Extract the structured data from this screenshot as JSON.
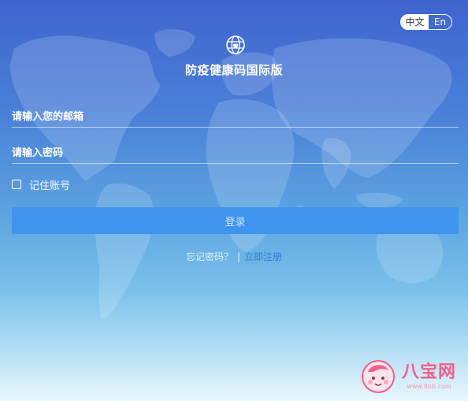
{
  "language": {
    "zh_label": "中文",
    "en_label": "En"
  },
  "header": {
    "title": "防疫健康码国际版",
    "logo_icon": "globe-heart-icon"
  },
  "form": {
    "email_placeholder": "请输入您的邮箱",
    "password_placeholder": "请输入密码",
    "remember_label": "记住账号",
    "remember_checked": false,
    "login_label": "登录"
  },
  "links": {
    "forgot": "忘记密码？",
    "divider": "|",
    "register": "立即注册"
  },
  "watermark": {
    "brand": "八宝网",
    "url": "www.8bb.com"
  },
  "colors": {
    "background_top": "#3f64cf",
    "background_bottom": "#e9f7fd",
    "button": "#3f94ee",
    "register_link": "#2d7cd8",
    "watermark": "#f0608a"
  }
}
